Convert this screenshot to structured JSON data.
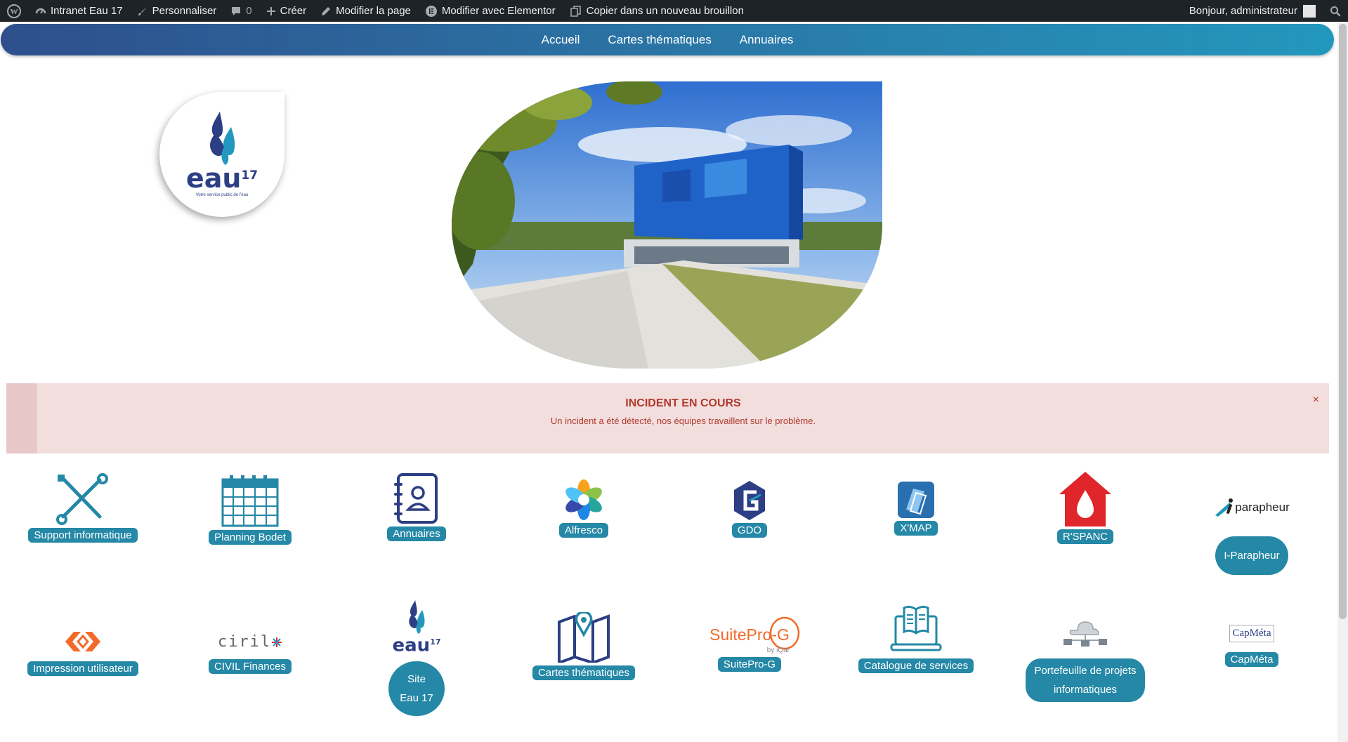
{
  "adminbar": {
    "site": "Intranet Eau 17",
    "customize": "Personnaliser",
    "comments": "0",
    "create": "Créer",
    "edit_page": "Modifier la page",
    "edit_elementor": "Modifier avec Elementor",
    "copy_draft": "Copier dans un nouveau brouillon",
    "greeting": "Bonjour, administrateur"
  },
  "nav": {
    "items": [
      "Accueil",
      "Cartes thématiques",
      "Annuaires"
    ]
  },
  "logo": {
    "name": "eau",
    "num": "17",
    "tagline": "Votre service public de l'eau"
  },
  "alert": {
    "title": "INCIDENT EN COURS",
    "message": "Un incident a été détecté, nos équipes travaillent sur le problème.",
    "close": "×"
  },
  "tiles_row1": [
    {
      "label": "Support informatique",
      "icon": "tools-icon"
    },
    {
      "label": "Planning Bodet",
      "icon": "calendar-icon"
    },
    {
      "label": "Annuaires",
      "icon": "address-book-icon"
    },
    {
      "label": "Alfresco",
      "icon": "alfresco-logo"
    },
    {
      "label": "GDO",
      "icon": "gdo-logo"
    },
    {
      "label": "X'MAP",
      "icon": "xmap-logo"
    },
    {
      "label": "R'SPANC",
      "icon": "house-drop-icon"
    },
    {
      "label": "I-Parapheur",
      "icon": "iparapheur-logo",
      "logo_text": "parapheur"
    }
  ],
  "tiles_row2": [
    {
      "label": "Impression utilisateur",
      "icon": "print-logo"
    },
    {
      "label": "CIVIL Finances",
      "icon": "ciril-logo",
      "logo_text": "ciril"
    },
    {
      "label_line1": "Site",
      "label_line2": "Eau 17",
      "icon": "eau17-logo"
    },
    {
      "label": "Cartes thématiques",
      "icon": "map-pin-icon"
    },
    {
      "label": "SuitePro-G",
      "icon": "suiteprog-logo",
      "logo_text": "SuitePro-G",
      "logo_sub": "by iQar"
    },
    {
      "label": "Catalogue de services",
      "icon": "catalog-icon"
    },
    {
      "label_line1": "Portefeuille de projets",
      "label_line2": "informatiques",
      "icon": "cloud-network-icon"
    },
    {
      "label": "CapMéta",
      "icon": "capmeta-logo",
      "logo_text": "CapMéta"
    }
  ],
  "colors": {
    "accent": "#2488a6",
    "nav_start": "#2e4f8c",
    "nav_end": "#2397bd",
    "alert_bg": "#f3dede",
    "alert_text": "#b13a2e"
  }
}
